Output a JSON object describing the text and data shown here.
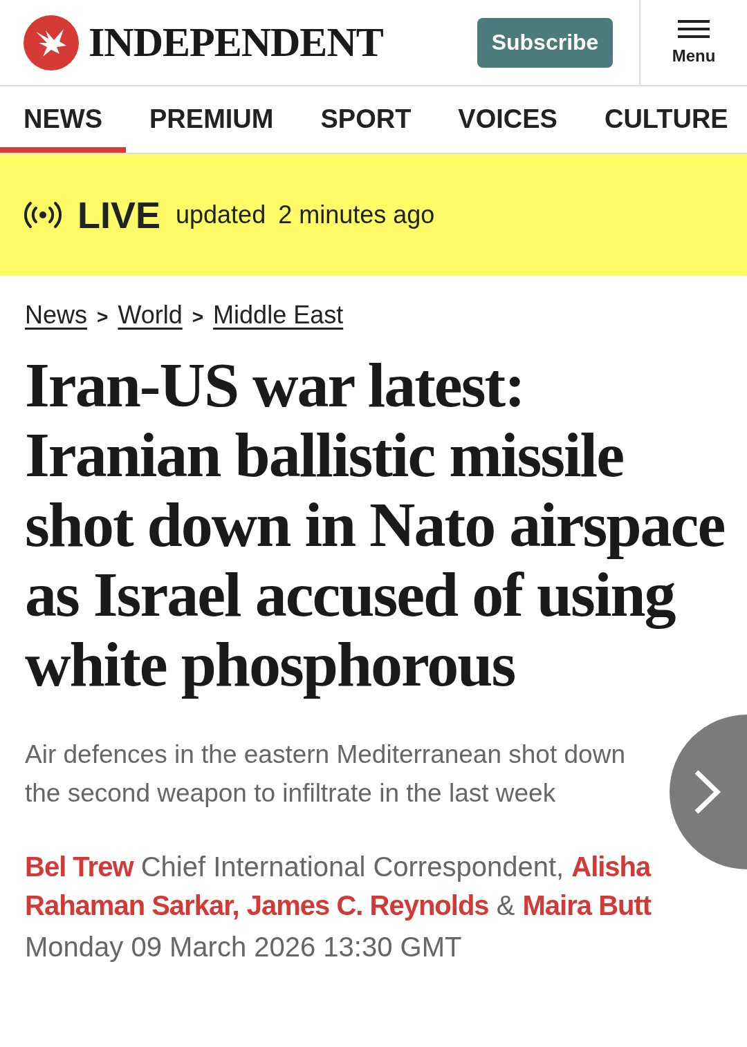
{
  "header": {
    "brand": "INDEPENDENT",
    "subscribe": "Subscribe",
    "menu": "Menu"
  },
  "tabs": [
    {
      "label": "NEWS",
      "selected": true
    },
    {
      "label": "PREMIUM",
      "selected": false
    },
    {
      "label": "SPORT",
      "selected": false
    },
    {
      "label": "VOICES",
      "selected": false
    },
    {
      "label": "CULTURE",
      "selected": false
    }
  ],
  "live_banner": {
    "label": "LIVE",
    "updated": "updated",
    "time": "2 minutes ago"
  },
  "breadcrumb": [
    {
      "label": "News",
      "separator": ">"
    },
    {
      "label": "World",
      "separator": ">"
    },
    {
      "label": "Middle East"
    }
  ],
  "headline": "Iran-US war latest: Iranian ballistic missile shot down in Nato airspace as Israel accused of using white phosphorous",
  "standfirst": "Air defences in the eastern Mediterranean shot down the second weapon to infiltrate in the last week",
  "byline": [
    {
      "kind": "author",
      "text": "Bel Trew"
    },
    {
      "kind": "text",
      "text": "Chief International Correspondent,"
    },
    {
      "kind": "author",
      "text": "Alisha"
    },
    {
      "kind": "author",
      "text": "Rahaman Sarkar,"
    },
    {
      "kind": "author",
      "text": "James C. Reynolds"
    },
    {
      "kind": "text",
      "text": "&"
    },
    {
      "kind": "author",
      "text": "Maira Butt"
    }
  ],
  "date": "Monday 09 March 2026 13:30 GMT"
}
